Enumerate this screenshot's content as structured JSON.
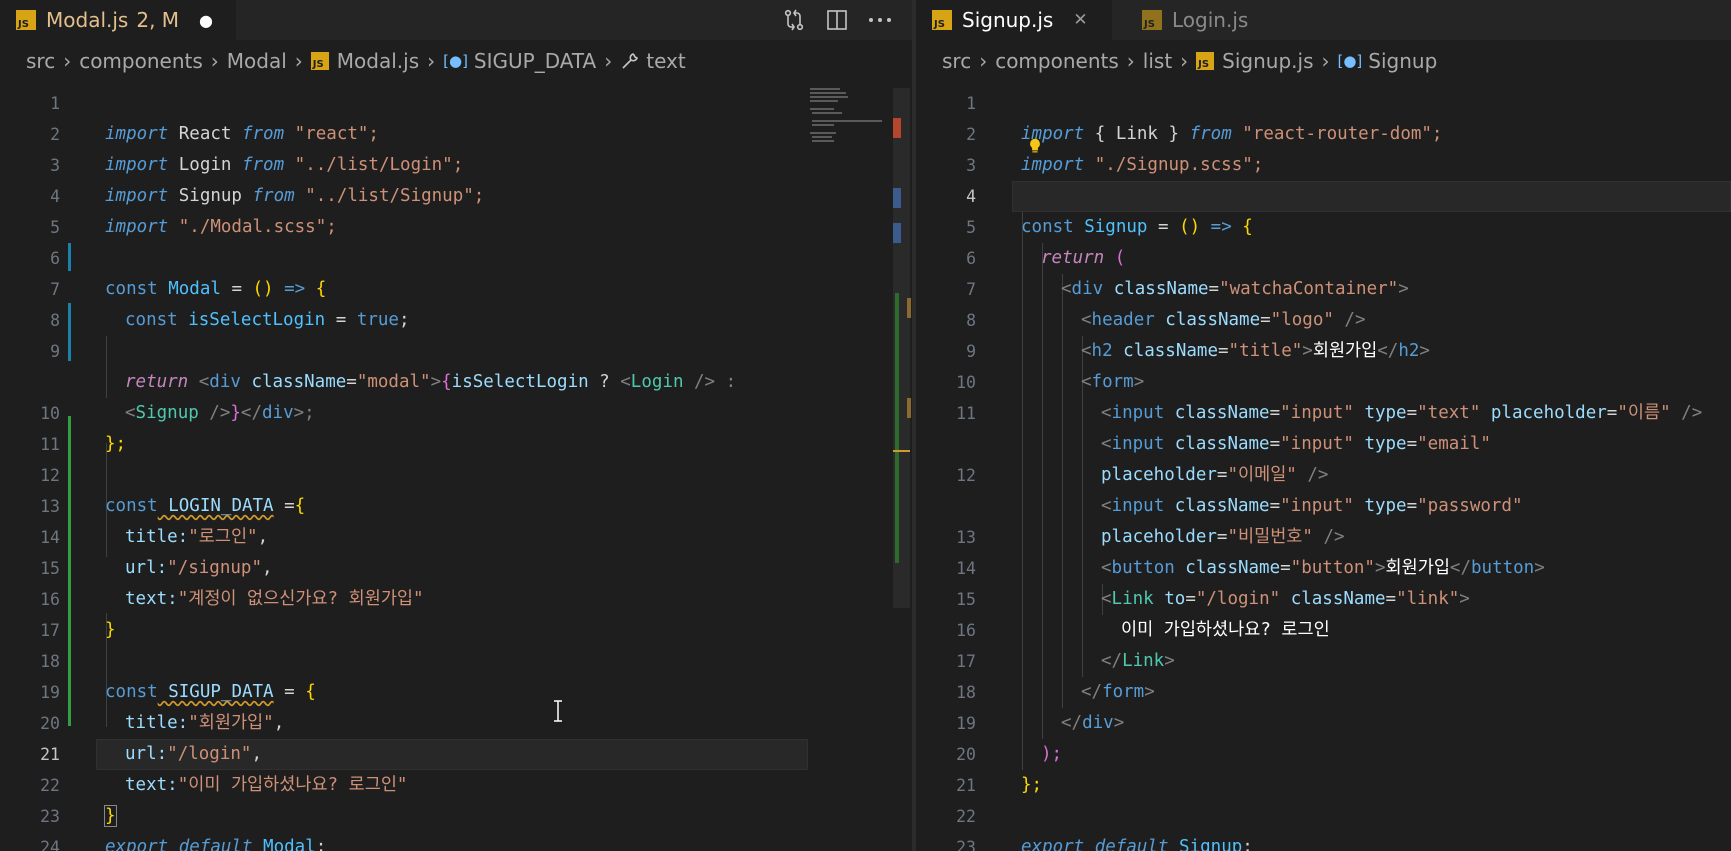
{
  "left": {
    "tab": {
      "icon": "js-file-icon",
      "name": "Modal.js",
      "status": "2, M",
      "dirty_dot": "●"
    },
    "breadcrumb": [
      "src",
      "components",
      "Modal",
      "Modal.js",
      "SIGUP_DATA",
      "text"
    ],
    "actions": [
      "git-compare-icon",
      "split-editor-icon",
      "more-actions-icon"
    ],
    "lines": [
      {
        "n": "1"
      },
      {
        "n": "2"
      },
      {
        "n": "3"
      },
      {
        "n": "4"
      },
      {
        "n": "5"
      },
      {
        "n": "6"
      },
      {
        "n": "7"
      },
      {
        "n": "8"
      },
      {
        "n": "9"
      },
      {
        "n": ""
      },
      {
        "n": "10"
      },
      {
        "n": "11"
      },
      {
        "n": "12"
      },
      {
        "n": "13"
      },
      {
        "n": "14"
      },
      {
        "n": "15"
      },
      {
        "n": "16"
      },
      {
        "n": "17"
      },
      {
        "n": "18"
      },
      {
        "n": "19"
      },
      {
        "n": "20"
      },
      {
        "n": "21"
      },
      {
        "n": "22"
      },
      {
        "n": "23"
      },
      {
        "n": "24"
      }
    ],
    "code": {
      "l1": [
        "import",
        " React ",
        "from",
        " \"react\";"
      ],
      "l2": [
        "import",
        " Login ",
        "from",
        " \"../list/Login\";"
      ],
      "l3": [
        "import",
        " Signup ",
        "from",
        " \"../list/Signup\";"
      ],
      "l4": [
        "import",
        " \"./Modal.scss\";"
      ],
      "l6": [
        "const",
        " Modal",
        " = ",
        "()",
        " => ",
        "{"
      ],
      "l7": [
        "const",
        " isSelectLogin",
        " = ",
        "true",
        ";"
      ],
      "l9a": [
        "return",
        " <",
        "div",
        " className",
        "=",
        "\"modal\"",
        ">",
        "{",
        "isSelectLogin",
        " ? ",
        "<",
        "Login",
        " /> :"
      ],
      "l9b": [
        "<",
        "Signup",
        " />",
        "}",
        "</",
        "div",
        ">;"
      ],
      "l10": [
        "};"
      ],
      "l12": [
        "const",
        " LOGIN_DATA",
        " =",
        "{"
      ],
      "l13": [
        "title:",
        "\"로그인\"",
        ","
      ],
      "l14": [
        "url:",
        "\"/signup\"",
        ","
      ],
      "l15": [
        "text:",
        "\"계정이 없으신가요? 회원가입\""
      ],
      "l16": [
        "}"
      ],
      "l18": [
        "const",
        " SIGUP_DATA",
        " = ",
        "{"
      ],
      "l19": [
        "title:",
        "\"회원가입\"",
        ","
      ],
      "l20": [
        "url:",
        "\"/login\"",
        ","
      ],
      "l21": [
        "text:",
        "\"이미 가입하셨나요? 로그인\""
      ],
      "l22": [
        "}"
      ],
      "l23": [
        "export",
        " default",
        " Modal",
        ";"
      ]
    }
  },
  "right": {
    "tabs": [
      {
        "icon": "js-file-icon",
        "name": "Signup.js",
        "close": "✕"
      },
      {
        "icon": "js-file-icon",
        "name": "Login.js"
      }
    ],
    "breadcrumb": [
      "src",
      "components",
      "list",
      "Signup.js",
      "Signup"
    ],
    "line_numbers": [
      "1",
      "2",
      "3",
      "4",
      "5",
      "6",
      "7",
      "8",
      "9",
      "10",
      "11",
      "",
      "12",
      "",
      "13",
      "14",
      "15",
      "16",
      "17",
      "18",
      "19",
      "20",
      "21",
      "22",
      "23"
    ],
    "code": {
      "l1": [
        "import",
        " { ",
        "Link",
        " } ",
        "from",
        " \"react-router-dom\";"
      ],
      "l2": [
        "import",
        " \"./Signup.scss\";"
      ],
      "l4": [
        "const",
        " Signup",
        " = ",
        "()",
        " => ",
        "{"
      ],
      "l5": [
        "return",
        " ("
      ],
      "l6": [
        "<",
        "div",
        " className",
        "=",
        "\"watchaContainer\"",
        ">"
      ],
      "l7": [
        "<",
        "header",
        " className",
        "=",
        "\"logo\"",
        " />"
      ],
      "l8": [
        "<",
        "h2",
        " className",
        "=",
        "\"title\"",
        ">",
        "회원가입",
        "</",
        "h2",
        ">"
      ],
      "l9": [
        "<",
        "form",
        ">"
      ],
      "l10": [
        "<",
        "input",
        " className",
        "=",
        "\"input\"",
        " type",
        "=",
        "\"text\"",
        " placeholder",
        "=",
        "\"이름\"",
        " />"
      ],
      "l11a": [
        "<",
        "input",
        " className",
        "=",
        "\"input\"",
        " type",
        "=",
        "\"email\""
      ],
      "l11b": [
        "placeholder",
        "=",
        "\"이메일\"",
        " />"
      ],
      "l12a": [
        "<",
        "input",
        " className",
        "=",
        "\"input\"",
        " type",
        "=",
        "\"password\""
      ],
      "l12b": [
        "placeholder",
        "=",
        "\"비밀번호\"",
        " />"
      ],
      "l13": [
        "<",
        "button",
        " className",
        "=",
        "\"button\"",
        ">",
        "회원가입",
        "</",
        "button",
        ">"
      ],
      "l14": [
        "<",
        "Link",
        " to",
        "=",
        "\"/login\"",
        " className",
        "=",
        "\"link\"",
        ">"
      ],
      "l15": [
        "이미 가입하셨나요? 로그인"
      ],
      "l16": [
        "</",
        "Link",
        ">"
      ],
      "l17": [
        "</",
        "form",
        ">"
      ],
      "l18": [
        "</",
        "div",
        ">"
      ],
      "l19": [
        ");"
      ],
      "l20": [
        "};"
      ],
      "l22": [
        "export",
        " default",
        " Signup",
        ";"
      ]
    }
  }
}
